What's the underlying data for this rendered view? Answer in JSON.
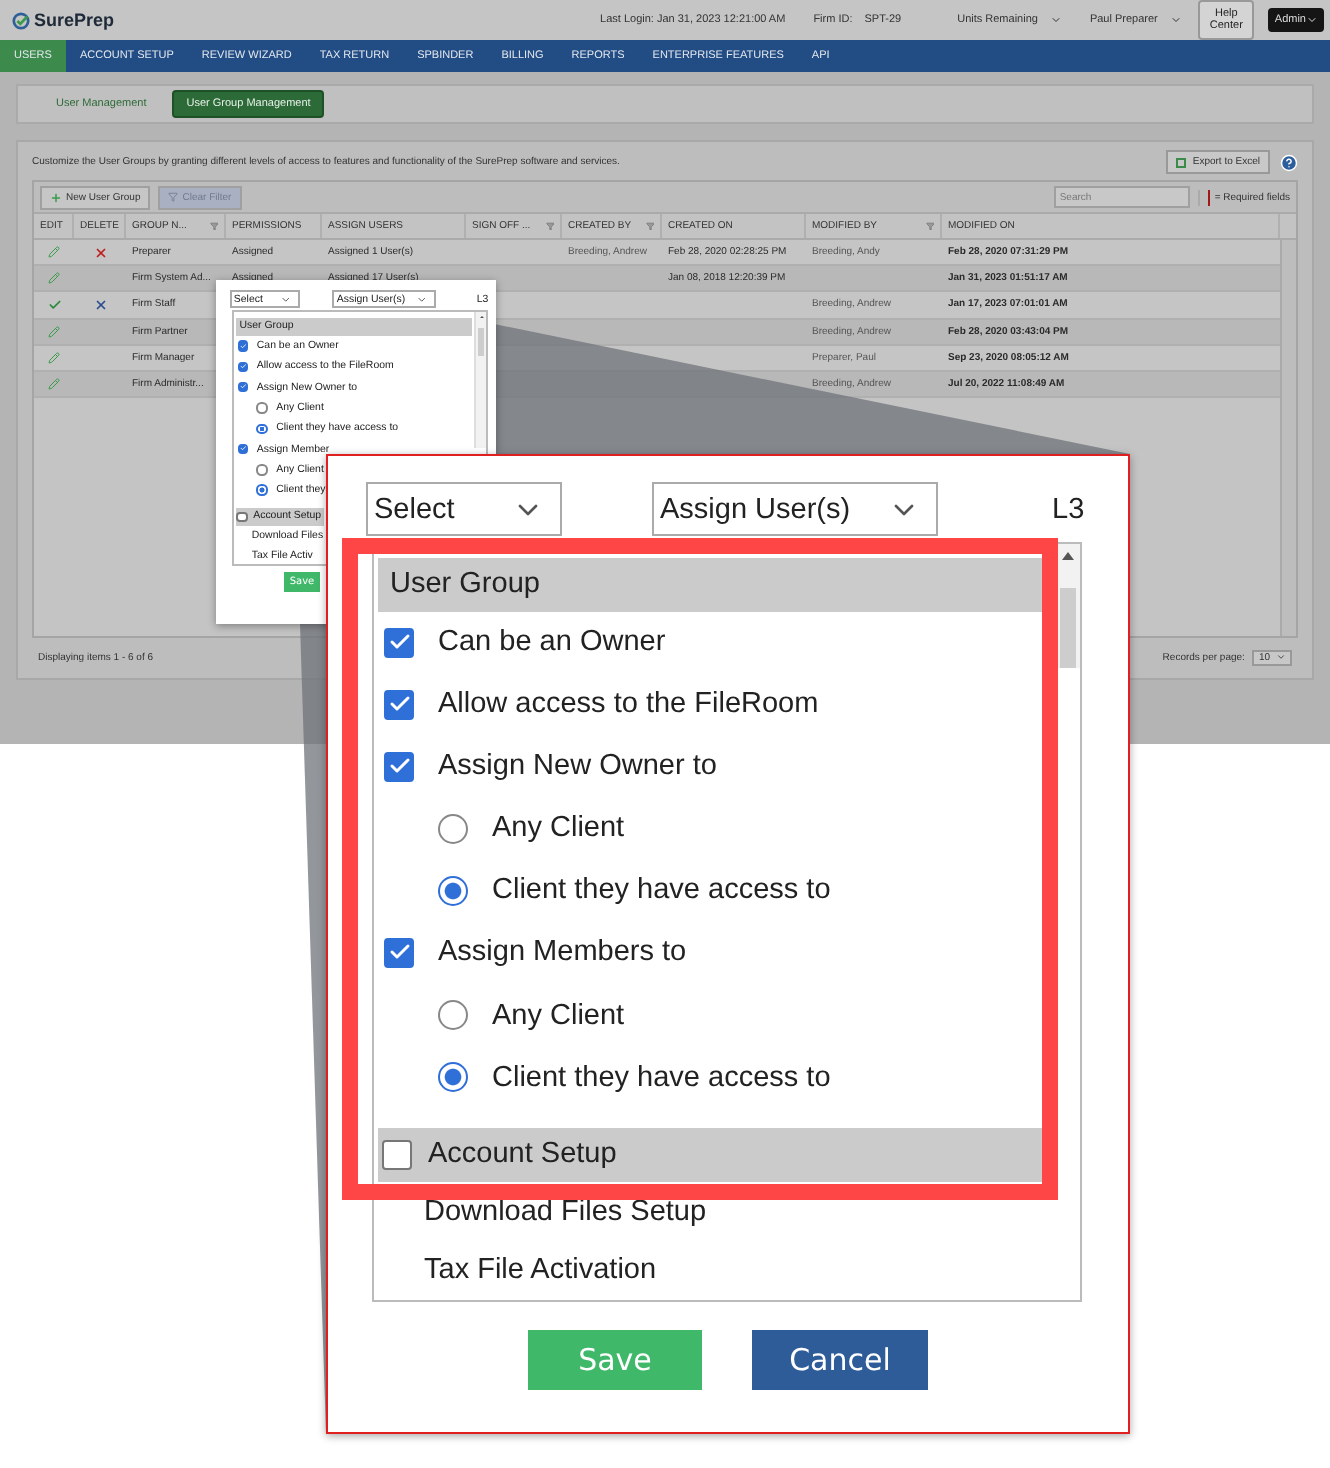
{
  "header": {
    "logo": "SurePrep",
    "last_login": "Last Login: Jan 31, 2023 12:21:00 AM",
    "firm_id_label": "Firm ID:",
    "firm_id": "SPT-29",
    "units_menu": "Units Remaining",
    "user_menu": "Paul Preparer",
    "help_button": "Help Center",
    "role_select": "Admin"
  },
  "nav": [
    {
      "label": "USERS",
      "selected": true
    },
    {
      "label": "ACCOUNT SETUP",
      "selected": false
    },
    {
      "label": "REVIEW WIZARD",
      "selected": false
    },
    {
      "label": "TAX RETURN",
      "selected": false
    },
    {
      "label": "SPBINDER",
      "selected": false
    },
    {
      "label": "BILLING",
      "selected": false
    },
    {
      "label": "REPORTS",
      "selected": false
    },
    {
      "label": "ENTERPRISE FEATURES",
      "selected": false
    },
    {
      "label": "API",
      "selected": false
    }
  ],
  "subtabs": [
    {
      "label": "User Management",
      "selected": false
    },
    {
      "label": "User Group Management",
      "selected": true
    }
  ],
  "panel": {
    "description": "Customize the User Groups by granting different levels of access to features and functionality of the SurePrep software and services.",
    "export_button": "Export to Excel",
    "new_button": "New User Group",
    "clear_button": "Clear Filter",
    "search": {
      "placeholder": "Search"
    },
    "required_note": "= Required fields"
  },
  "table": {
    "columns": [
      {
        "label": "EDIT"
      },
      {
        "label": "DELETE"
      },
      {
        "label": "GROUP N...",
        "filter": true
      },
      {
        "label": "PERMISSIONS"
      },
      {
        "label": "ASSIGN USERS"
      },
      {
        "label": "SIGN OFF ...",
        "filter": true
      },
      {
        "label": "CREATED BY",
        "filter": true
      },
      {
        "label": "CREATED ON"
      },
      {
        "label": "MODIFIED BY",
        "filter": true
      },
      {
        "label": "MODIFIED ON"
      }
    ],
    "rows": [
      {
        "editing": false,
        "deletable": true,
        "group": "Preparer",
        "permissions": "Assigned",
        "assign_users": "Assigned 1 User(s)",
        "created_by": "Breeding, Andrew",
        "created_on": "Feb 28, 2020 02:28:25 PM",
        "modified_by": "Breeding, Andy",
        "modified_on": "Feb 28, 2020 07:31:29 PM"
      },
      {
        "editing": false,
        "deletable": false,
        "group": "Firm System Ad...",
        "permissions": "Assigned",
        "assign_users": "Assigned 17 User(s)",
        "created_on": "Jan 08, 2018 12:20:39 PM",
        "modified_on": "Jan 31, 2023 01:51:17 AM"
      },
      {
        "editing": true,
        "group": "Firm Staff",
        "modified_by": "Breeding, Andrew",
        "modified_on": "Jan 17, 2023 07:01:01 AM"
      },
      {
        "editing": false,
        "deletable": false,
        "group": "Firm Partner",
        "modified_by": "Breeding, Andrew",
        "modified_on": "Feb 28, 2020 03:43:04 PM"
      },
      {
        "editing": false,
        "deletable": false,
        "group": "Firm Manager",
        "modified_by": "Preparer, Paul",
        "modified_on": "Sep 23, 2020 08:05:12 AM"
      },
      {
        "editing": false,
        "deletable": false,
        "group": "Firm Administr...",
        "modified_by": "Breeding, Andrew",
        "modified_on": "Jul 20, 2022 11:08:49 AM"
      }
    ]
  },
  "footer": {
    "summary": "Displaying items 1 - 6 of 6",
    "page_size_label": "Records per page:",
    "page_size": "10"
  },
  "thumbnail": {
    "permission_select": "Select",
    "assign_select": "Assign User(s)",
    "level": "L3",
    "items": [
      {
        "kind": "header",
        "label": "User Group"
      },
      {
        "kind": "checkbox",
        "label": "Can be an Owner",
        "checked": true
      },
      {
        "kind": "checkbox",
        "label": "Allow access to the FileRoom",
        "checked": true
      },
      {
        "kind": "checkbox",
        "label": "Assign New Owner to",
        "checked": true
      },
      {
        "kind": "radio",
        "label": "Any Client",
        "selected": false
      },
      {
        "kind": "radio",
        "label": "Client they have access to",
        "selected": true
      },
      {
        "kind": "checkbox",
        "label": "Assign Member",
        "checked": true
      },
      {
        "kind": "radio",
        "label": "Any Client",
        "selected": false
      },
      {
        "kind": "radio",
        "label": "Client they",
        "selected": true
      },
      {
        "kind": "header_checkbox",
        "label": "Account Setup",
        "checked": false
      },
      {
        "kind": "plain",
        "label": "Download Files"
      },
      {
        "kind": "plain",
        "label": "Tax File Activ"
      }
    ],
    "save_button": "Save"
  },
  "callout": {
    "permission_select": "Select",
    "assign_select": "Assign User(s)",
    "level": "L3",
    "items": [
      {
        "kind": "header",
        "label": "User Group"
      },
      {
        "kind": "checkbox",
        "label": "Can be an Owner",
        "checked": true
      },
      {
        "kind": "checkbox",
        "label": "Allow access to the FileRoom",
        "checked": true
      },
      {
        "kind": "checkbox",
        "label": "Assign New Owner to",
        "checked": true
      },
      {
        "kind": "radio",
        "label": "Any Client",
        "selected": false
      },
      {
        "kind": "radio",
        "label": "Client they have access to",
        "selected": true
      },
      {
        "kind": "checkbox",
        "label": "Assign Members to",
        "checked": true
      },
      {
        "kind": "radio",
        "label": "Any Client",
        "selected": false
      },
      {
        "kind": "radio",
        "label": "Client they have access to",
        "selected": true
      },
      {
        "kind": "header_checkbox",
        "label": "Account Setup",
        "checked": false
      },
      {
        "kind": "plain",
        "label": "Download Files Setup"
      },
      {
        "kind": "plain",
        "label": "Tax File Activation"
      }
    ],
    "save_button": "Save",
    "cancel_button": "Cancel"
  }
}
